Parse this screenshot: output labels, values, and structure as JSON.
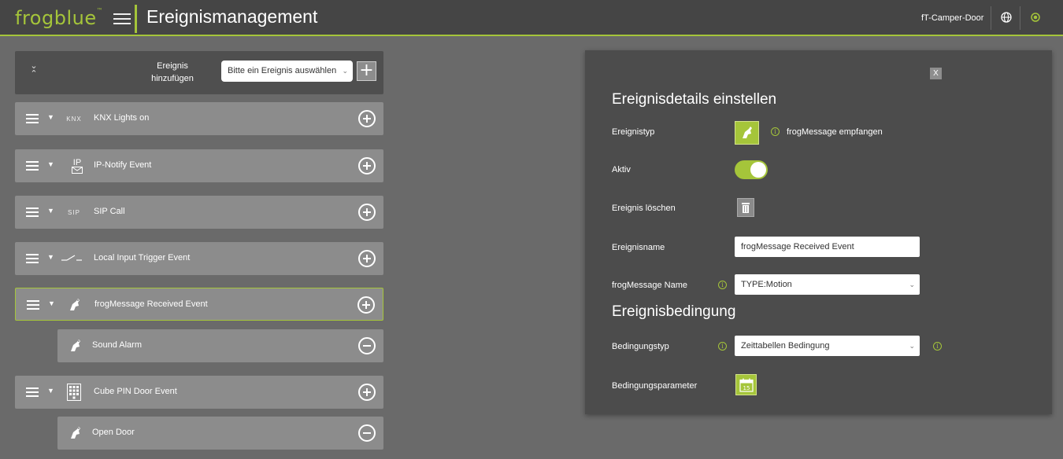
{
  "header": {
    "logo": "frogblue",
    "logo_mark": "™",
    "title": "Ereignismanagement",
    "device": "fT-Camper-Door",
    "icons": [
      "globe-icon",
      "status-icon"
    ]
  },
  "add_event": {
    "label_line1": "Ereignis",
    "label_line2": "hinzufügen",
    "select_placeholder": "Bitte ein Ereignis auswählen",
    "add_symbol": "+"
  },
  "events": [
    {
      "icon": "knx-icon",
      "tag": "KNX",
      "label": "KNX Lights on"
    },
    {
      "icon": "ip-notify-icon",
      "tag": "IP",
      "label": "IP-Notify Event"
    },
    {
      "icon": "sip-icon",
      "tag": "SIP",
      "label": "SIP Call"
    },
    {
      "icon": "switch-icon",
      "label": "Local Input Trigger Event"
    },
    {
      "icon": "frog-icon",
      "label": "frogMessage Received Event",
      "selected": true
    },
    {
      "icon": "frog-icon",
      "label": "Sound Alarm",
      "sub": true
    },
    {
      "icon": "keypad-icon",
      "label": "Cube PIN Door Event"
    },
    {
      "icon": "frog-icon",
      "label": "Open Door",
      "sub": true
    }
  ],
  "details": {
    "close_label": "X",
    "section_title": "Ereignisdetails einstellen",
    "type_label": "Ereignistyp",
    "type_value": "frogMessage empfangen",
    "active_label": "Aktiv",
    "active": true,
    "delete_label": "Ereignis löschen",
    "name_label": "Ereignisname",
    "name_value": "frogMessage Received Event",
    "msg_name_label": "frogMessage Name",
    "msg_name_value": "TYPE:Motion",
    "condition_title": "Ereignisbedingung",
    "cond_type_label": "Bedingungstyp",
    "cond_type_value": "Zeittabellen Bedingung",
    "cond_param_label": "Bedingungsparameter",
    "calendar_day": "15"
  },
  "colors": {
    "accent": "#a5c53a",
    "header_bg": "#454545",
    "page_bg": "#6a6a6a",
    "panel_bg": "#4c4c4c",
    "row_bg": "#8c8c8c"
  }
}
